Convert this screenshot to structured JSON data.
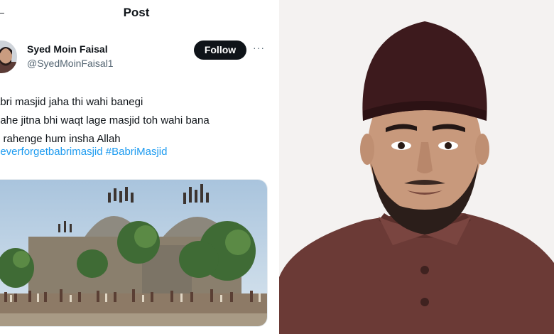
{
  "post": {
    "header_title": "Post",
    "author": {
      "name": "Syed Moin Faisal",
      "handle": "@SyedMoinFaisal1"
    },
    "follow_label": "Follow",
    "more_label": "···",
    "back_label": "←",
    "text_lines": [
      "abri masjid jaha thi wahi banegi",
      "hahe jitna bhi waqt lage masjid toh wahi bana",
      "e rahenge hum insha Allah"
    ],
    "hashtags": [
      "neverforgetbabrimasjid",
      "#BabriMasjid"
    ]
  },
  "icons": {
    "back": "arrow-left-icon",
    "more": "more-horizontal-icon"
  },
  "colors": {
    "text_primary": "#0f1419",
    "text_secondary": "#536471",
    "link": "#1d9bf0",
    "follow_bg": "#0f1419",
    "portrait_bg": "#f4f2f1",
    "kurta": "#6b3a36",
    "cap": "#3d1a1d"
  }
}
